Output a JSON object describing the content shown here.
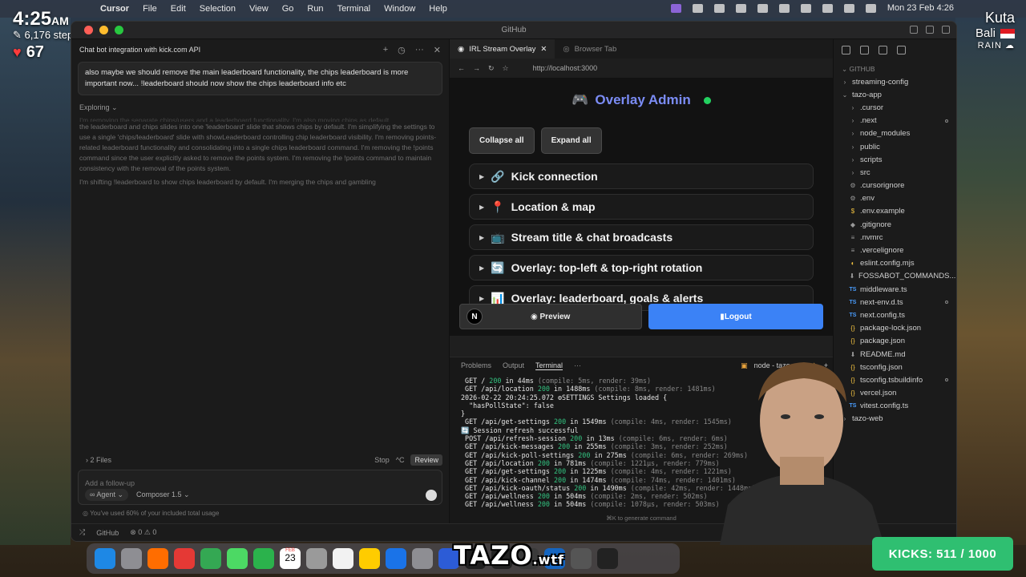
{
  "menubar": {
    "app": "Cursor",
    "menus": [
      "Cursor",
      "File",
      "Edit",
      "Selection",
      "View",
      "Go",
      "Run",
      "Terminal",
      "Window",
      "Help"
    ],
    "datetime": "Mon 23 Feb  4:26"
  },
  "overlay": {
    "time": "4:25",
    "ampm": "AM",
    "steps": "6,176 steps",
    "heart_rate": "67",
    "city": "Kuta",
    "region": "Bali",
    "weather": "RAIN",
    "kicks": "KICKS: 511 / 1000",
    "logo": "TAZO",
    "logo_suffix": ".wtf"
  },
  "window": {
    "title": "GitHub"
  },
  "chat": {
    "title": "Chat bot integration with kick.com API",
    "user_message": "also maybe we should remove the main leaderboard functionality, the chips leaderboard is more important now... !leaderboard should now show the chips leaderboard info etc",
    "exploring_label": "Exploring",
    "thinking_top": "I'm removing the separate chips/users and a leaderboard functionality. I'm also moving chips as default...",
    "thinking_1": "the leaderboard and chips slides into one 'leaderboard' slide that shows chips by default. I'm simplifying the settings to use a single 'chips/leaderboard' slide with showLeaderboard controlling chip leaderboard visibility. I'm removing points-related leaderboard functionality and consolidating into a single chips leaderboard command. I'm removing the !points command since the user explicitly asked to remove the points system. I'm removing the !points command to maintain consistency with the removal of the points system.",
    "thinking_2": "I'm shifting !leaderboard to show chips leaderboard by default. I'm merging the chips and gambling",
    "files_label": "2 Files",
    "stop_label": "Stop",
    "stop_shortcut": "^C",
    "review_label": "Review",
    "input_placeholder": "Add a follow-up",
    "agent_label": "Agent",
    "model_label": "Composer 1.5",
    "usage_text": "You've used 60% of your included total usage"
  },
  "browser": {
    "tabs": [
      "IRL Stream Overlay",
      "Browser Tab"
    ],
    "url": "http://localhost:3000",
    "page_title": "Overlay Admin",
    "collapse_all": "Collapse all",
    "expand_all": "Expand all",
    "sections": [
      {
        "icon": "🔗",
        "label": "Kick connection"
      },
      {
        "icon": "📍",
        "label": "Location & map"
      },
      {
        "icon": "📺",
        "label": "Stream title & chat broadcasts"
      },
      {
        "icon": "🔄",
        "label": "Overlay: top-left & top-right rotation"
      },
      {
        "icon": "📊",
        "label": "Overlay: leaderboard, goals & alerts"
      }
    ],
    "preview_label": "Preview",
    "logout_label": "Logout",
    "n_badge": "N"
  },
  "terminal": {
    "tabs": [
      "Problems",
      "Output",
      "Terminal"
    ],
    "process": "node - tazo-app",
    "lines": [
      {
        "t": " GET / ",
        "s": "200",
        "r": " in 44ms ",
        "d": "(compile: 5ms, render: 39ms)"
      },
      {
        "t": " GET /api/location ",
        "s": "200",
        "r": " in 1488ms ",
        "d": "(compile: 8ms, render: 1481ms)"
      },
      {
        "t": "2026-02-22 20:24:25.072 ⚙SETTINGS Settings loaded {",
        "s": "",
        "r": "",
        "d": ""
      },
      {
        "t": "  \"hasPollState\": false",
        "s": "",
        "r": "",
        "d": ""
      },
      {
        "t": "}",
        "s": "",
        "r": "",
        "d": ""
      },
      {
        "t": " GET /api/get-settings ",
        "s": "200",
        "r": " in 1549ms ",
        "d": "(compile: 4ms, render: 1545ms)"
      },
      {
        "t": "🔄 Session refresh successful",
        "s": "",
        "r": "",
        "d": ""
      },
      {
        "t": " POST /api/refresh-session ",
        "s": "200",
        "r": " in 13ms ",
        "d": "(compile: 6ms, render: 6ms)"
      },
      {
        "t": " GET /api/kick-messages ",
        "s": "200",
        "r": " in 255ms ",
        "d": "(compile: 3ms, render: 252ms)"
      },
      {
        "t": " GET /api/kick-poll-settings ",
        "s": "200",
        "r": " in 275ms ",
        "d": "(compile: 6ms, render: 269ms)"
      },
      {
        "t": " GET /api/location ",
        "s": "200",
        "r": " in 781ms ",
        "d": "(compile: 1221µs, render: 779ms)"
      },
      {
        "t": " GET /api/get-settings ",
        "s": "200",
        "r": " in 1225ms ",
        "d": "(compile: 4ms, render: 1221ms)"
      },
      {
        "t": " GET /api/kick-channel ",
        "s": "200",
        "r": " in 1474ms ",
        "d": "(compile: 74ms, render: 1401ms)"
      },
      {
        "t": " GET /api/kick-oauth/status ",
        "s": "200",
        "r": " in 1490ms ",
        "d": "(compile: 42ms, render: 1448ms)"
      },
      {
        "t": " GET /api/wellness ",
        "s": "200",
        "r": " in 504ms ",
        "d": "(compile: 2ms, render: 502ms)"
      },
      {
        "t": " GET /api/wellness ",
        "s": "200",
        "r": " in 504ms ",
        "d": "(compile: 1078µs, render: 503ms)"
      }
    ],
    "hint": "⌘K to generate command"
  },
  "explorer": {
    "root": "GITHUB",
    "items": [
      {
        "name": "streaming-config",
        "type": "folder",
        "depth": 0
      },
      {
        "name": "tazo-app",
        "type": "folder-open",
        "depth": 0
      },
      {
        "name": ".cursor",
        "type": "folder",
        "depth": 1
      },
      {
        "name": ".next",
        "type": "folder",
        "depth": 1,
        "mod": true
      },
      {
        "name": "node_modules",
        "type": "folder",
        "depth": 1
      },
      {
        "name": "public",
        "type": "folder",
        "depth": 1
      },
      {
        "name": "scripts",
        "type": "folder",
        "depth": 1
      },
      {
        "name": "src",
        "type": "folder",
        "depth": 1
      },
      {
        "name": ".cursorignore",
        "type": "gear",
        "depth": 1
      },
      {
        "name": ".env",
        "type": "gear",
        "depth": 1
      },
      {
        "name": ".env.example",
        "type": "dollar",
        "depth": 1
      },
      {
        "name": ".gitignore",
        "type": "diamond",
        "depth": 1
      },
      {
        "name": ".nvmrc",
        "type": "file",
        "depth": 1
      },
      {
        "name": ".vercelignore",
        "type": "file",
        "depth": 1
      },
      {
        "name": "eslint.config.mjs",
        "type": "js",
        "depth": 1
      },
      {
        "name": "FOSSABOT_COMMANDS....",
        "type": "md",
        "depth": 1
      },
      {
        "name": "middleware.ts",
        "type": "ts",
        "depth": 1
      },
      {
        "name": "next-env.d.ts",
        "type": "ts",
        "depth": 1,
        "mod": true
      },
      {
        "name": "next.config.ts",
        "type": "ts",
        "depth": 1
      },
      {
        "name": "package-lock.json",
        "type": "json",
        "depth": 1
      },
      {
        "name": "package.json",
        "type": "json",
        "depth": 1
      },
      {
        "name": "README.md",
        "type": "md",
        "depth": 1
      },
      {
        "name": "tsconfig.json",
        "type": "json",
        "depth": 1
      },
      {
        "name": "tsconfig.tsbuildinfo",
        "type": "json",
        "depth": 1,
        "mod": true
      },
      {
        "name": "vercel.json",
        "type": "json",
        "depth": 1
      },
      {
        "name": "vitest.config.ts",
        "type": "ts",
        "depth": 1
      },
      {
        "name": "tazo-web",
        "type": "folder",
        "depth": 0
      }
    ]
  },
  "statusbar": {
    "branch": "GitHub",
    "problems": "⊗ 0 ⚠ 0"
  },
  "dock": {
    "calendar_day": "23",
    "calendar_month": "FEB",
    "colors": [
      "#1e88e5",
      "#8e8e93",
      "#ff6d00",
      "#e53935",
      "#34a853",
      "#4cd964",
      "#2bb24c",
      "#d0d0d0",
      "#9a9a9a",
      "#f2f2f2",
      "#ffcc00",
      "#1a73e8",
      "#8e8e93",
      "#2c5cd6",
      "#1e1e1e",
      "#222",
      "#3a3a3a",
      "#1565c0",
      "#555",
      "#222"
    ]
  }
}
